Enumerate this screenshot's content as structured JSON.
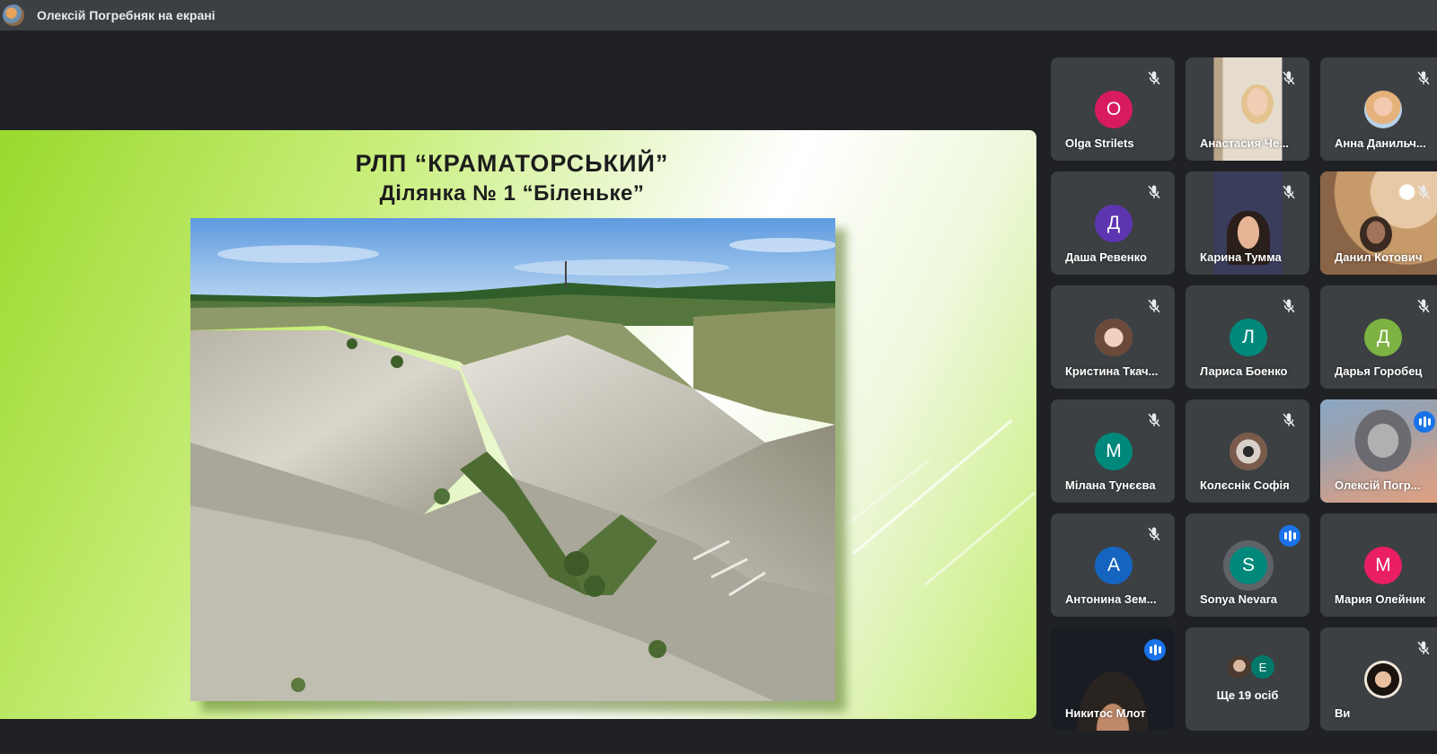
{
  "topbar": {
    "presenting_text": "Олексій Погребняк на екрані"
  },
  "slide": {
    "title_line1": "РЛП “КРАМАТОРСЬКИЙ”",
    "title_line2": "Ділянка № 1 “Біленьке”"
  },
  "participants": [
    {
      "name": "Olga Strilets",
      "initial": "O",
      "color": "#d81b60",
      "kind": "initial",
      "status": "muted"
    },
    {
      "name": "Анастасия Че...",
      "kind": "video",
      "status": "muted"
    },
    {
      "name": "Анна Данильч...",
      "kind": "photo",
      "status": "muted"
    },
    {
      "name": "Даша Ревенко",
      "initial": "Д",
      "color": "#5e35b1",
      "kind": "initial",
      "status": "muted"
    },
    {
      "name": "Карина Тумма",
      "kind": "video",
      "status": "muted"
    },
    {
      "name": "Данил Котович",
      "kind": "video",
      "status": "muted"
    },
    {
      "name": "Кристина Ткач...",
      "kind": "photo",
      "status": "muted"
    },
    {
      "name": "Лариса Боенко",
      "initial": "Л",
      "color": "#00897b",
      "kind": "initial",
      "status": "muted"
    },
    {
      "name": "Дарья Горобец",
      "initial": "Д",
      "color": "#7cb342",
      "kind": "initial",
      "status": "muted"
    },
    {
      "name": "Мілана Тунєєва",
      "initial": "М",
      "color": "#00897b",
      "kind": "initial",
      "status": "muted"
    },
    {
      "name": "Колєснік Софія",
      "kind": "photo",
      "status": "muted"
    },
    {
      "name": "Олексій Погр...",
      "kind": "video",
      "status": "speaking"
    },
    {
      "name": "Антонина Зем...",
      "initial": "А",
      "color": "#1565c0",
      "kind": "initial",
      "status": "muted"
    },
    {
      "name": "Sonya Nevara",
      "initial": "S",
      "color": "#00897b",
      "kind": "initial",
      "status": "speaking"
    },
    {
      "name": "Мария Олейник",
      "initial": "М",
      "color": "#e91e63",
      "kind": "initial",
      "status": "none"
    },
    {
      "name": "Никитос Млот",
      "kind": "video",
      "status": "speaking"
    },
    {
      "name": "Ще 19 осіб",
      "kind": "more",
      "extra_initial": "Е",
      "extra_color": "#00796b",
      "status": "none"
    },
    {
      "name": "Ви",
      "kind": "photo",
      "status": "muted"
    }
  ],
  "colors": {
    "background": "#202124",
    "topbar": "#3c4043",
    "tile": "#3c4043",
    "speaking_blue": "#1a73e8"
  }
}
